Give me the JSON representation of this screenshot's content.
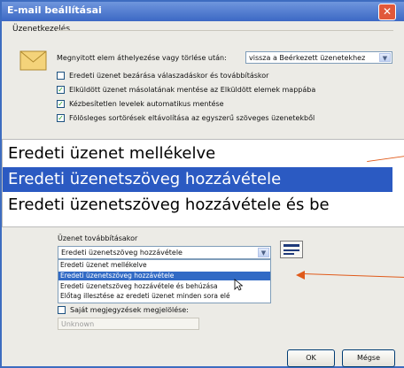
{
  "window": {
    "title": "E-mail beállításai",
    "close_glyph": "✕"
  },
  "group": {
    "label": "Üzenetkezelés"
  },
  "move_delete": {
    "label": "Megnyitott elem áthelyezése vagy törlése után:",
    "selected": "vissza a Beérkezett üzenetekhez"
  },
  "options": [
    {
      "label": "Eredeti üzenet bezárása válaszadáskor és továbbításkor",
      "checked": false
    },
    {
      "label": "Elküldött üzenet másolatának mentése az Elküldött elemek mappába",
      "checked": true
    },
    {
      "label": "Kézbesítetlen levelek automatikus mentése",
      "checked": true
    },
    {
      "label": "Fölösleges sortörések eltávolítása az egyszerű szöveges üzenetekből",
      "checked": true
    }
  ],
  "zoom": {
    "items": [
      "Eredeti üzenet mellékelve",
      "Eredeti üzenetszöveg hozzávétele",
      "Eredeti üzenetszöveg hozzávétele és be"
    ],
    "selected_index": 1
  },
  "forward": {
    "label": "Üzenet továbbításakor",
    "selected": "Eredeti üzenetszöveg hozzávétele",
    "options": [
      "Eredeti üzenet mellékelve",
      "Eredeti üzenetszöveg hozzávétele",
      "Eredeti üzenetszöveg hozzávétele és behúzása",
      "Előtag illesztése az eredeti üzenet minden sora elé"
    ],
    "selected_index": 1
  },
  "comments": {
    "label": "Saját megjegyzések megjelölése:",
    "checked": false,
    "value": "Unknown"
  },
  "buttons": {
    "ok": "OK",
    "cancel": "Mégse"
  },
  "colors": {
    "title_bar": "#3c68c4",
    "selection": "#316ac5",
    "callout": "#e05a1a",
    "check": "#21a121"
  }
}
